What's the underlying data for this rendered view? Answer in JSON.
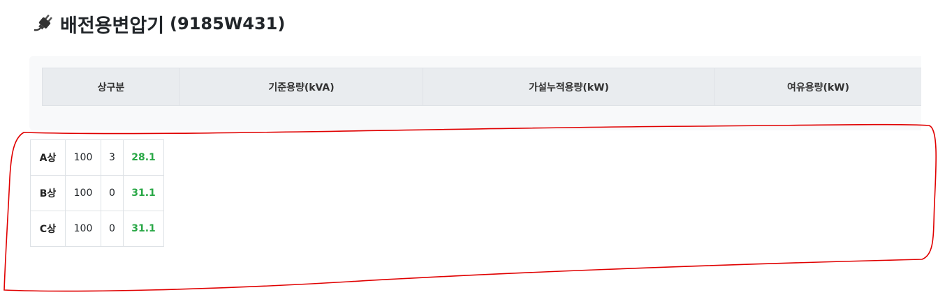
{
  "title": {
    "icon": "plug-icon",
    "name": "배전용변압기",
    "code": "(9185W431)"
  },
  "table": {
    "headers": [
      "상구분",
      "기준용량(kVA)",
      "가설누적용량(kW)",
      "여유용량(kW)"
    ],
    "rows": [
      {
        "phase": "A상",
        "base": "100",
        "accum": "3",
        "avail": "28.1"
      },
      {
        "phase": "B상",
        "base": "100",
        "accum": "0",
        "avail": "31.1"
      },
      {
        "phase": "C상",
        "base": "100",
        "accum": "0",
        "avail": "31.1"
      }
    ]
  },
  "colors": {
    "available_value": "#28a745",
    "annotation": "#e00000",
    "header_background": "#e9ecef",
    "card_background": "#f8f9fa"
  },
  "annotation": {
    "type": "hand-drawn-outline",
    "color": "#e00000"
  }
}
